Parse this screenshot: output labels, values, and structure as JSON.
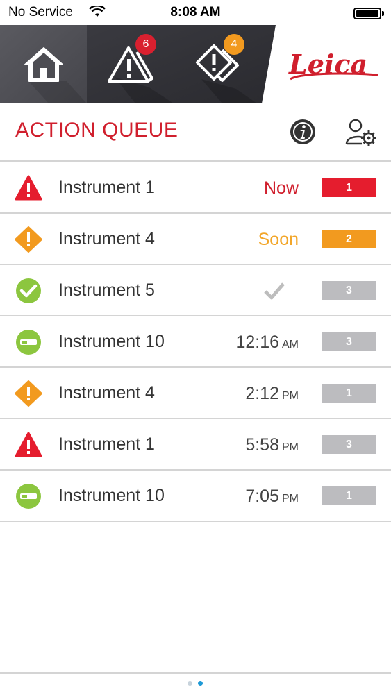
{
  "status_bar": {
    "carrier": "No Service",
    "time": "8:08 AM"
  },
  "nav": {
    "tabs": [
      {
        "name": "home",
        "icon": "home-icon"
      },
      {
        "name": "alerts",
        "icon": "alert-triangle-icon",
        "badge": "6",
        "badge_color": "#d9202f"
      },
      {
        "name": "warnings",
        "icon": "warning-diamond-icon",
        "badge": "4",
        "badge_color": "#f29a1f"
      }
    ],
    "logo_text": "Leica"
  },
  "header": {
    "title": "ACTION QUEUE",
    "info_icon": "info-icon",
    "settings_icon": "user-settings-icon"
  },
  "queue": [
    {
      "status": "error",
      "icon": "red-triangle-icon",
      "name": "Instrument 1",
      "time": "Now",
      "ampm": "",
      "time_style": "now",
      "count": "1",
      "count_color": "red"
    },
    {
      "status": "warning",
      "icon": "orange-diamond-icon",
      "name": "Instrument 4",
      "time": "Soon",
      "ampm": "",
      "time_style": "soon",
      "count": "2",
      "count_color": "orange"
    },
    {
      "status": "ok",
      "icon": "green-check-icon",
      "name": "Instrument 5",
      "time": "",
      "ampm": "",
      "time_style": "check",
      "count": "3",
      "count_color": "grey"
    },
    {
      "status": "idle",
      "icon": "green-minus-icon",
      "name": "Instrument 10",
      "time": "12:16",
      "ampm": "AM",
      "time_style": "clock",
      "count": "3",
      "count_color": "grey"
    },
    {
      "status": "warning",
      "icon": "orange-diamond-icon",
      "name": "Instrument 4",
      "time": "2:12",
      "ampm": "PM",
      "time_style": "clock",
      "count": "1",
      "count_color": "grey"
    },
    {
      "status": "error",
      "icon": "red-triangle-icon",
      "name": "Instrument 1",
      "time": "5:58",
      "ampm": "PM",
      "time_style": "clock",
      "count": "3",
      "count_color": "grey"
    },
    {
      "status": "idle",
      "icon": "green-minus-icon",
      "name": "Instrument 10",
      "time": "7:05",
      "ampm": "PM",
      "time_style": "clock",
      "count": "1",
      "count_color": "grey"
    }
  ],
  "pager": {
    "pages": 2,
    "current": 2
  },
  "colors": {
    "brand_red": "#d01f2d",
    "orange": "#f29a1f",
    "green": "#8cc63f",
    "grey_badge": "#bcbcbf",
    "nav_dark": "#2e2e33",
    "pager_active": "#1f9ad6"
  }
}
